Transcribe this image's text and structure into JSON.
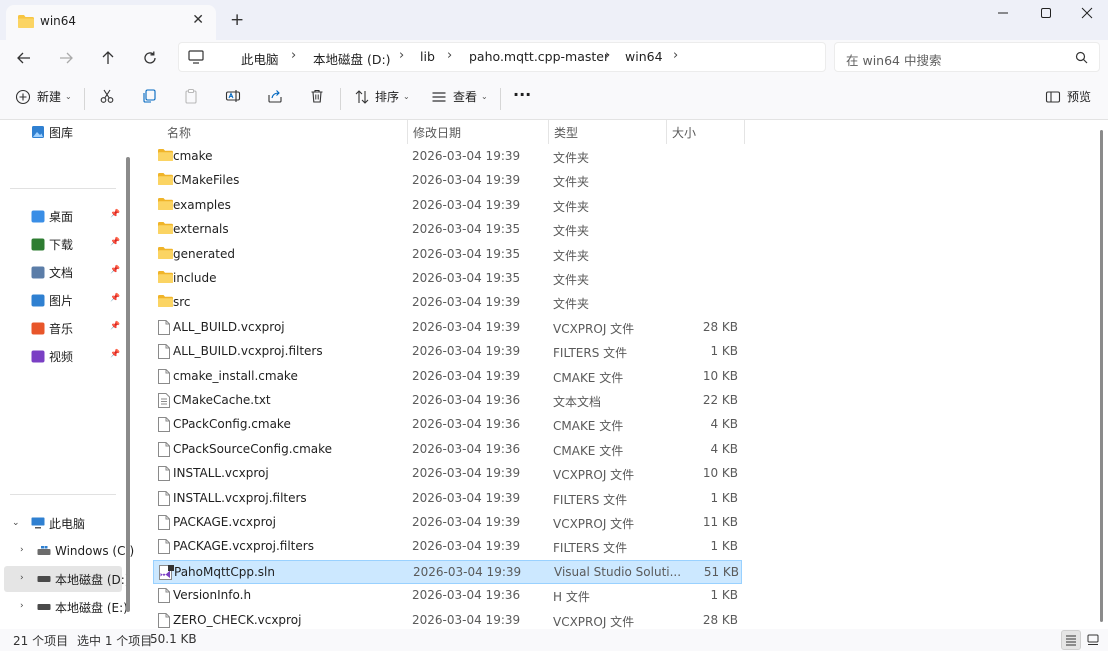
{
  "window": {
    "tab_title": "win64",
    "new_tab_symbol": "+",
    "controls": {
      "minimize": "—",
      "maximize": "☐",
      "close": "✕"
    }
  },
  "nav": {
    "breadcrumbs": [
      "此电脑",
      "本地磁盘 (D:)",
      "lib",
      "paho.mqtt.cpp-master",
      "win64"
    ],
    "search_placeholder": "在 win64 中搜索"
  },
  "toolbar": {
    "new_label": "新建",
    "sort_label": "排序",
    "view_label": "查看",
    "more_label": "···",
    "preview_label": "预览"
  },
  "sidebar": {
    "gallery": "图库",
    "quick_access": [
      {
        "label": "桌面",
        "icon": "desktop-icon",
        "color": "#3a8ee6"
      },
      {
        "label": "下载",
        "icon": "download-icon",
        "color": "#2e7d32"
      },
      {
        "label": "文档",
        "icon": "documents-icon",
        "color": "#5b7da8"
      },
      {
        "label": "图片",
        "icon": "pictures-icon",
        "color": "#2f80d1"
      },
      {
        "label": "音乐",
        "icon": "music-icon",
        "color": "#e8562a"
      },
      {
        "label": "视频",
        "icon": "videos-icon",
        "color": "#7a3fc4"
      }
    ],
    "this_pc": "此电脑",
    "drives": [
      "Windows (C:)",
      "本地磁盘 (D:)",
      "本地磁盘 (E:)"
    ]
  },
  "columns": {
    "name": "名称",
    "date": "修改日期",
    "type": "类型",
    "size": "大小"
  },
  "files": [
    {
      "name": "cmake",
      "date": "2026-03-04 19:39",
      "type": "文件夹",
      "size": "",
      "icon": "folder"
    },
    {
      "name": "CMakeFiles",
      "date": "2026-03-04 19:39",
      "type": "文件夹",
      "size": "",
      "icon": "folder"
    },
    {
      "name": "examples",
      "date": "2026-03-04 19:39",
      "type": "文件夹",
      "size": "",
      "icon": "folder"
    },
    {
      "name": "externals",
      "date": "2026-03-04 19:35",
      "type": "文件夹",
      "size": "",
      "icon": "folder"
    },
    {
      "name": "generated",
      "date": "2026-03-04 19:35",
      "type": "文件夹",
      "size": "",
      "icon": "folder"
    },
    {
      "name": "include",
      "date": "2026-03-04 19:35",
      "type": "文件夹",
      "size": "",
      "icon": "folder"
    },
    {
      "name": "src",
      "date": "2026-03-04 19:39",
      "type": "文件夹",
      "size": "",
      "icon": "folder"
    },
    {
      "name": "ALL_BUILD.vcxproj",
      "date": "2026-03-04 19:39",
      "type": "VCXPROJ 文件",
      "size": "28 KB",
      "icon": "file"
    },
    {
      "name": "ALL_BUILD.vcxproj.filters",
      "date": "2026-03-04 19:39",
      "type": "FILTERS 文件",
      "size": "1 KB",
      "icon": "file"
    },
    {
      "name": "cmake_install.cmake",
      "date": "2026-03-04 19:39",
      "type": "CMAKE 文件",
      "size": "10 KB",
      "icon": "file"
    },
    {
      "name": "CMakeCache.txt",
      "date": "2026-03-04 19:36",
      "type": "文本文档",
      "size": "22 KB",
      "icon": "text"
    },
    {
      "name": "CPackConfig.cmake",
      "date": "2026-03-04 19:36",
      "type": "CMAKE 文件",
      "size": "4 KB",
      "icon": "file"
    },
    {
      "name": "CPackSourceConfig.cmake",
      "date": "2026-03-04 19:36",
      "type": "CMAKE 文件",
      "size": "4 KB",
      "icon": "file"
    },
    {
      "name": "INSTALL.vcxproj",
      "date": "2026-03-04 19:39",
      "type": "VCXPROJ 文件",
      "size": "10 KB",
      "icon": "file"
    },
    {
      "name": "INSTALL.vcxproj.filters",
      "date": "2026-03-04 19:39",
      "type": "FILTERS 文件",
      "size": "1 KB",
      "icon": "file"
    },
    {
      "name": "PACKAGE.vcxproj",
      "date": "2026-03-04 19:39",
      "type": "VCXPROJ 文件",
      "size": "11 KB",
      "icon": "file"
    },
    {
      "name": "PACKAGE.vcxproj.filters",
      "date": "2026-03-04 19:39",
      "type": "FILTERS 文件",
      "size": "1 KB",
      "icon": "file"
    },
    {
      "name": "PahoMqttCpp.sln",
      "date": "2026-03-04 19:39",
      "type": "Visual Studio Soluti...",
      "size": "51 KB",
      "icon": "sln",
      "selected": true
    },
    {
      "name": "VersionInfo.h",
      "date": "2026-03-04 19:36",
      "type": "H 文件",
      "size": "1 KB",
      "icon": "file"
    },
    {
      "name": "ZERO_CHECK.vcxproj",
      "date": "2026-03-04 19:39",
      "type": "VCXPROJ 文件",
      "size": "28 KB",
      "icon": "file"
    }
  ],
  "status": {
    "count": "21 个项目",
    "selected": "选中 1 个项目",
    "selected_size": "50.1 KB"
  },
  "colors": {
    "folder": "#f7c542",
    "accent": "#0067c0",
    "selection": "#cce8ff"
  }
}
